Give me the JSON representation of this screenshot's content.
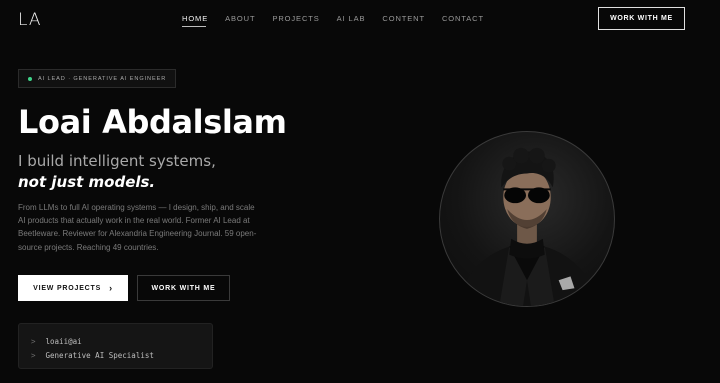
{
  "header": {
    "logo": "LA",
    "nav": [
      "HOME",
      "ABOUT",
      "PROJECTS",
      "AI LAB",
      "CONTENT",
      "CONTACT"
    ],
    "cta": "WORK WITH ME"
  },
  "hero": {
    "badge": "AI LEAD · GENERATIVE AI ENGINEER",
    "name": "Loai Abdalslam",
    "tagline_line1": "I build intelligent systems,",
    "tagline_line2": "not just models.",
    "description": "From LLMs to full AI operating systems — I design, ship, and scale AI products that actually work in the real world. Former AI Lead at Beetleware. Reviewer for Alexandria Engineering Journal. 59 open-source projects. Reaching 49 countries.",
    "primary_button": "VIEW PROJECTS",
    "secondary_button": "WORK WITH ME"
  },
  "terminal": {
    "prompt": ">",
    "lines": [
      "loaii@ai",
      "Generative AI Specialist"
    ]
  },
  "colors": {
    "background": "#080808",
    "status_dot": "#3fd58a"
  },
  "icons": {
    "badge_dot": "status-dot-icon",
    "button_arrow": "chevron-right-icon"
  }
}
